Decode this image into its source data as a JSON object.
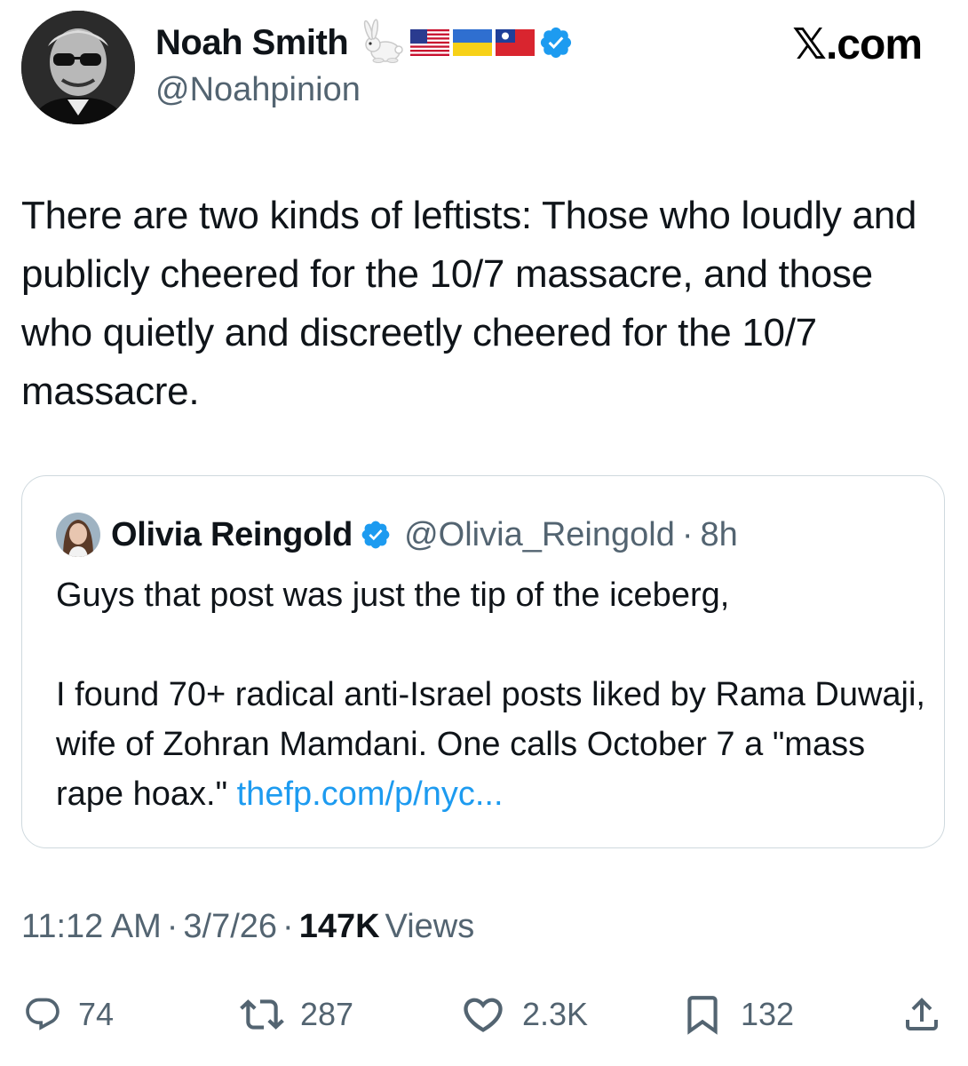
{
  "author": {
    "display_name": "Noah Smith",
    "handle": "@Noahpinion",
    "name_emojis": [
      "rabbit",
      "flag-us",
      "flag-ua",
      "flag-tw"
    ],
    "verified": true
  },
  "brand": "𝕏.com",
  "tweet_text": "There are two kinds of leftists: Those who loudly and publicly cheered for the 10/7 massacre, and those who quietly and discreetly cheered for the 10/7 massacre.",
  "quoted": {
    "display_name": "Olivia Reingold",
    "handle": "@Olivia_Reingold",
    "separator": "·",
    "time": "8h",
    "verified": true,
    "text": "Guys that post was just the tip of the iceberg,\n\nI found 70+ radical anti-Israel posts liked by Rama Duwaji, wife of Zohran Mamdani. One calls October 7 a \"mass rape hoax.\" ",
    "link": "thefp.com/p/nyc..."
  },
  "meta": {
    "time": "11:12 AM",
    "sep1": "·",
    "date": "3/7/26",
    "sep2": "·",
    "views_count": "147K",
    "views_label": "Views"
  },
  "actions": {
    "replies": "74",
    "reposts": "287",
    "likes": "2.3K",
    "bookmarks": "132"
  },
  "colors": {
    "text": "#0f1419",
    "secondary": "#536471",
    "link": "#1d9bf0",
    "verified": "#1d9bf0",
    "border": "#cfd9de"
  },
  "icons": [
    "verified-badge-icon",
    "reply-icon",
    "repost-icon",
    "like-icon",
    "bookmark-icon",
    "share-icon"
  ]
}
